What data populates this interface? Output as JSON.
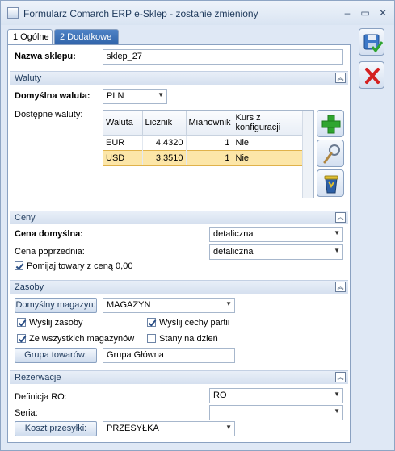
{
  "window": {
    "title": "Formularz Comarch ERP e-Sklep - zostanie zmieniony",
    "min_glyph": "–",
    "max_glyph": "▭",
    "close_glyph": "✕"
  },
  "tabs": [
    {
      "label": "1 Ogólne",
      "active": true
    },
    {
      "label": "2 Dodatkowe",
      "active": false
    }
  ],
  "shop": {
    "name_label": "Nazwa sklepu:",
    "name_value": "sklep_27"
  },
  "waluty": {
    "header": "Waluty",
    "default_label": "Domyślna waluta:",
    "default_value": "PLN",
    "available_label": "Dostępne waluty:",
    "columns": [
      "Waluta",
      "Licznik",
      "Mianownik",
      "Kurs z konfiguracji"
    ],
    "rows": [
      {
        "waluta": "EUR",
        "licznik": "4,4320",
        "mianownik": "1",
        "kurs": "Nie",
        "selected": false
      },
      {
        "waluta": "USD",
        "licznik": "3,3510",
        "mianownik": "1",
        "kurs": "Nie",
        "selected": true
      }
    ]
  },
  "ceny": {
    "header": "Ceny",
    "default_label": "Cena domyślna:",
    "default_value": "detaliczna",
    "previous_label": "Cena poprzednia:",
    "previous_value": "detaliczna",
    "skip_zero_label": "Pomijaj towary z ceną 0,00",
    "skip_zero_checked": true
  },
  "zasoby": {
    "header": "Zasoby",
    "warehouse_button": "Domyślny magazyn:",
    "warehouse_value": "MAGAZYN",
    "send_stock_label": "Wyślij zasoby",
    "send_stock_checked": true,
    "send_batch_label": "Wyślij cechy partii",
    "send_batch_checked": true,
    "all_warehouses_label": "Ze wszystkich magazynów",
    "all_warehouses_checked": true,
    "stock_on_day_label": "Stany na dzień",
    "stock_on_day_checked": false,
    "group_button": "Grupa towarów:",
    "group_value": "Grupa Główna"
  },
  "rezerwacje": {
    "header": "Rezerwacje",
    "ro_label": "Definicja RO:",
    "ro_value": "RO",
    "series_label": "Seria:",
    "series_value": "",
    "shipping_button": "Koszt przesyłki:",
    "shipping_value": "PRZESYŁKA"
  },
  "icons": {
    "save": "save-icon",
    "cancel": "cancel-icon",
    "add": "plus-icon",
    "edit": "magnifier-icon",
    "delete": "trash-icon"
  },
  "colors": {
    "accent": "#2f62a8",
    "selection": "#fce6a8",
    "add_green": "#2fa52f",
    "cancel_red": "#d42020"
  }
}
